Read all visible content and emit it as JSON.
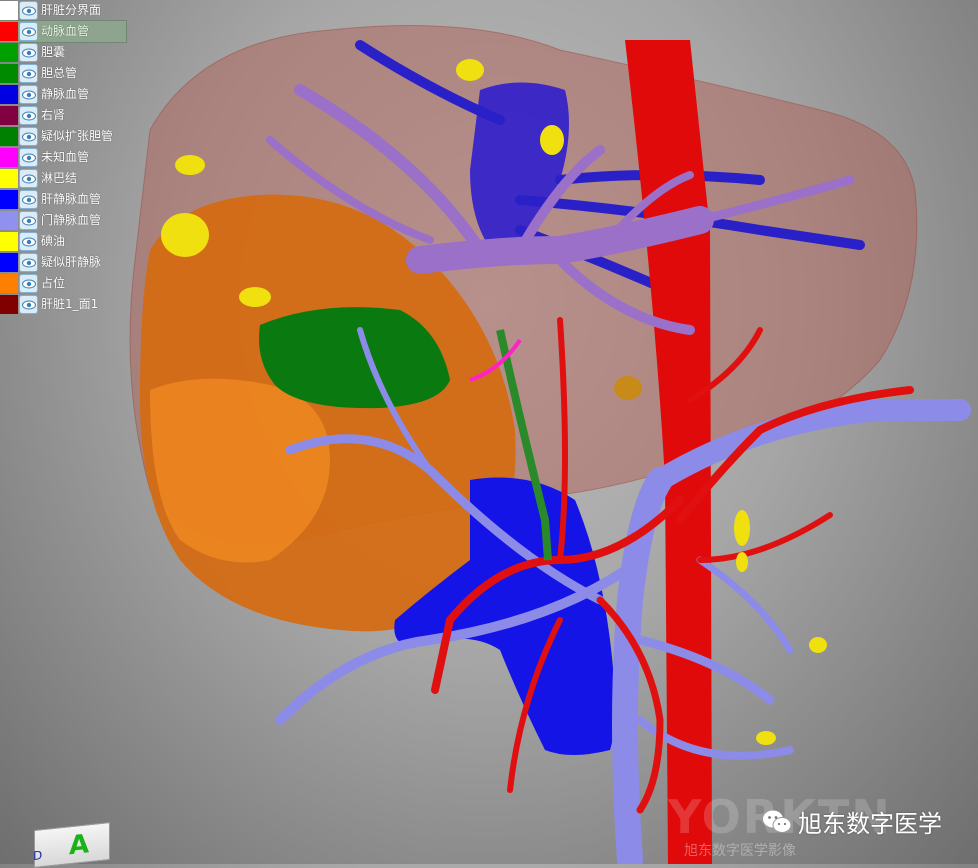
{
  "layers": [
    {
      "label": "肝脏分界面",
      "color": "#ffffff",
      "selected": false
    },
    {
      "label": "动脉血管",
      "color": "#ff0000",
      "selected": true
    },
    {
      "label": "胆囊",
      "color": "#00a000",
      "selected": false
    },
    {
      "label": "胆总管",
      "color": "#008a00",
      "selected": false
    },
    {
      "label": "静脉血管",
      "color": "#0000e0",
      "selected": false
    },
    {
      "label": "右肾",
      "color": "#800040",
      "selected": false
    },
    {
      "label": "疑似扩张胆管",
      "color": "#008000",
      "selected": false
    },
    {
      "label": "未知血管",
      "color": "#ff00ff",
      "selected": false
    },
    {
      "label": "淋巴结",
      "color": "#ffff00",
      "selected": false
    },
    {
      "label": "肝静脉血管",
      "color": "#0000ff",
      "selected": false
    },
    {
      "label": "门静脉血管",
      "color": "#9090ee",
      "selected": false
    },
    {
      "label": "碘油",
      "color": "#ffff00",
      "selected": false
    },
    {
      "label": "疑似肝静脉",
      "color": "#0000ff",
      "selected": false
    },
    {
      "label": "占位",
      "color": "#ff8000",
      "selected": false
    },
    {
      "label": "肝脏1_面1",
      "color": "#800000",
      "selected": false
    }
  ],
  "icons": {
    "visibility": "eye-icon",
    "badge": "wechat-icon"
  },
  "navcube": {
    "front": "A",
    "left": "D"
  },
  "watermark": {
    "logo": "YORKTN",
    "sub": "旭东数字医学影像"
  },
  "badge": {
    "text": "旭东数字医学"
  }
}
